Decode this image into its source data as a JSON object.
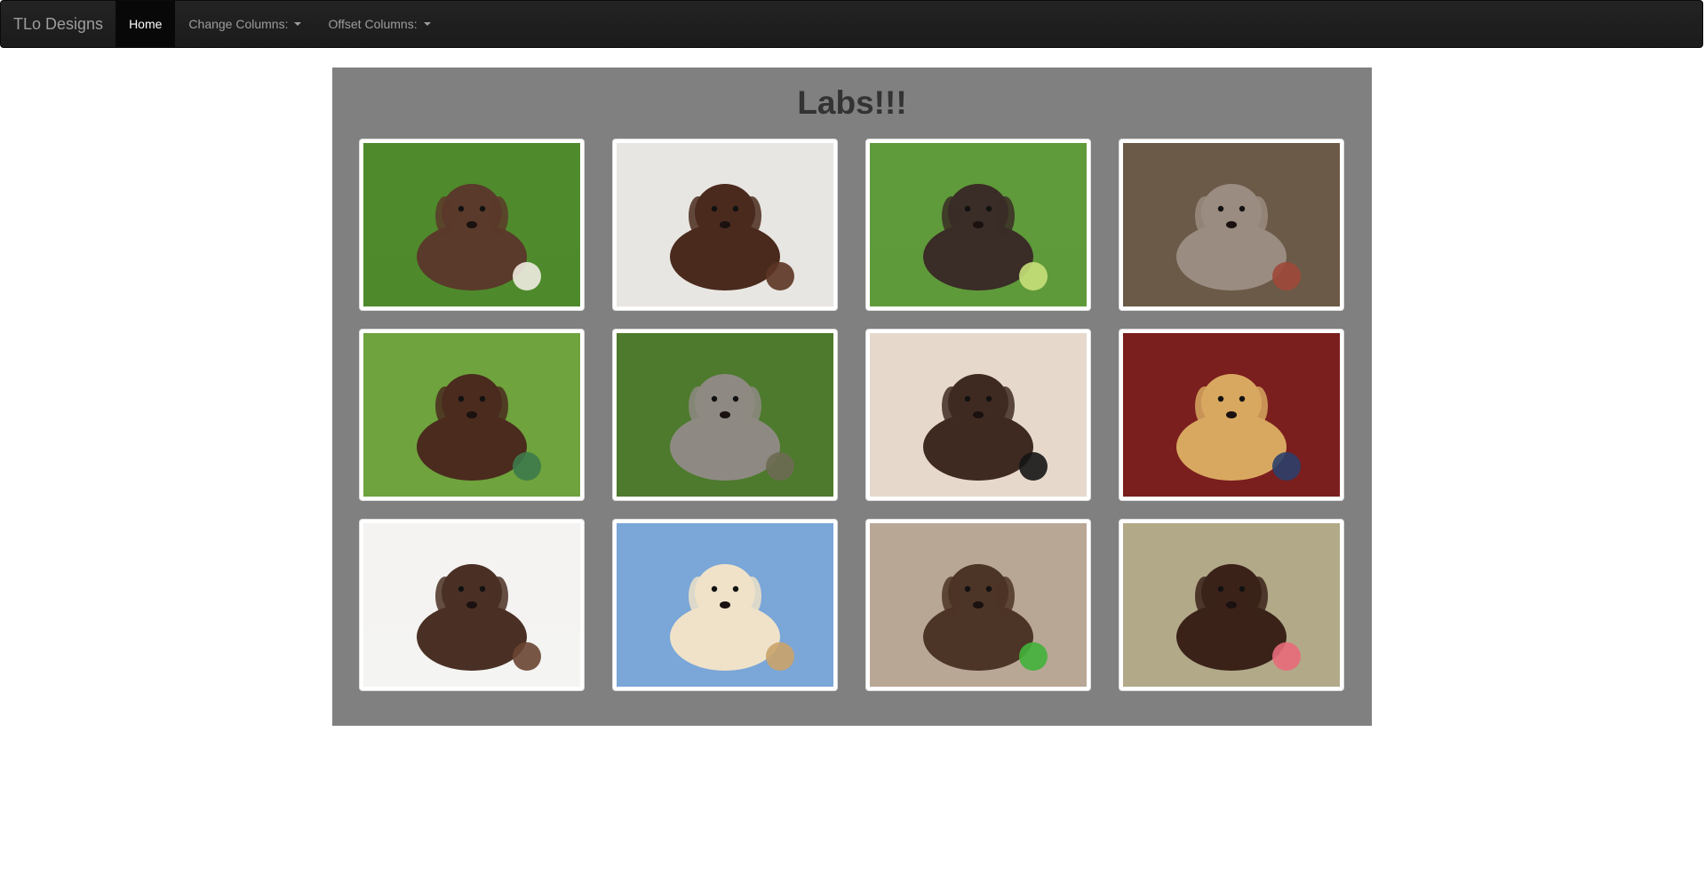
{
  "navbar": {
    "brand": "TLo Designs",
    "items": [
      {
        "label": "Home",
        "active": true,
        "dropdown": false
      },
      {
        "label": "Change Columns:",
        "active": false,
        "dropdown": true
      },
      {
        "label": "Offset Columns:",
        "active": false,
        "dropdown": true
      }
    ]
  },
  "gallery": {
    "title": "Labs!!!",
    "panel_color": "#808080",
    "images": [
      {
        "subject": "yellow-and-chocolate-puppies-on-grass",
        "bg": "#4f8a2c",
        "fg": "#5a3a2a",
        "accent": "#f0ebe0"
      },
      {
        "subject": "chocolate-puppy-closeup",
        "bg": "#e8e6e2",
        "fg": "#4a2a1d",
        "accent": "#5c3424"
      },
      {
        "subject": "chocolate-puppy-with-ball-on-grass",
        "bg": "#5f9a3b",
        "fg": "#3a2c26",
        "accent": "#c8e07a"
      },
      {
        "subject": "silver-puppy-lying-in-garden",
        "bg": "#6b5a47",
        "fg": "#9a8c80",
        "accent": "#a0483a"
      },
      {
        "subject": "chocolate-puppy-with-green-bandana",
        "bg": "#6fa33d",
        "fg": "#4a2b1e",
        "accent": "#3d7a4a"
      },
      {
        "subject": "silver-puppy-sitting-by-tree",
        "bg": "#4d7a2c",
        "fg": "#8e8a83",
        "accent": "#6d6a52"
      },
      {
        "subject": "black-and-chocolate-puppies-cuddling",
        "bg": "#e6d9cc",
        "fg": "#3f2a22",
        "accent": "#151515"
      },
      {
        "subject": "golden-puppies-with-christmas-presents",
        "bg": "#7a1e1e",
        "fg": "#d8a860",
        "accent": "#2c3f6a"
      },
      {
        "subject": "chocolate-lab-lying-on-white",
        "bg": "#f4f3f2",
        "fg": "#4a3024",
        "accent": "#6a4532"
      },
      {
        "subject": "yellow-puppy-resting-head",
        "bg": "#7aa6d8",
        "fg": "#efe2c8",
        "accent": "#c9a36a"
      },
      {
        "subject": "chocolate-puppy-with-green-ball",
        "bg": "#b9a796",
        "fg": "#4c3426",
        "accent": "#42b33a"
      },
      {
        "subject": "chocolate-lab-lying-on-dry-grass",
        "bg": "#b2a989",
        "fg": "#3a2219",
        "accent": "#e86a7a"
      }
    ]
  }
}
